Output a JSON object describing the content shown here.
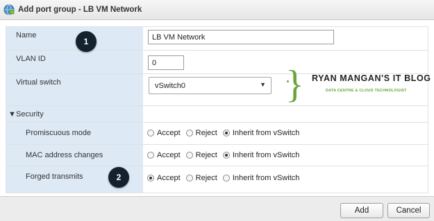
{
  "dialog": {
    "title": "Add port group - LB VM Network",
    "icon": "network-icon"
  },
  "form": {
    "name": {
      "label": "Name",
      "value": "LB VM Network"
    },
    "vlan": {
      "label": "VLAN ID",
      "value": "0"
    },
    "vswitch": {
      "label": "Virtual switch",
      "selected": "vSwitch0"
    },
    "security": {
      "label": "Security",
      "options": [
        "Accept",
        "Reject",
        "Inherit from vSwitch"
      ],
      "promiscuous": {
        "label": "Promiscuous mode",
        "selected": "Inherit from vSwitch"
      },
      "mac": {
        "label": "MAC address changes",
        "selected": "Inherit from vSwitch"
      },
      "forged": {
        "label": "Forged transmits",
        "selected": "Accept"
      }
    }
  },
  "annotations": {
    "badge1": "1",
    "badge2": "2"
  },
  "watermark": {
    "title": "RYAN MANGAN'S IT BLOG",
    "subtitle": "DATA CENTRE & CLOUD TECHNOLOGIST",
    "accent": "#6aa53a"
  },
  "footer": {
    "add_label": "Add",
    "cancel_label": "Cancel"
  }
}
